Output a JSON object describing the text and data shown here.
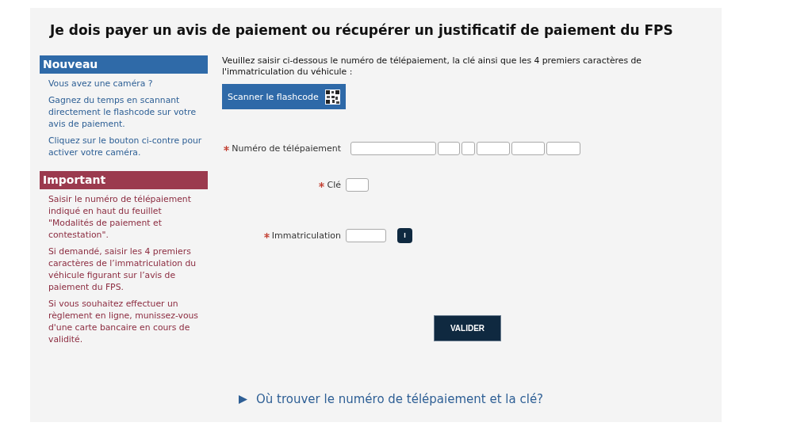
{
  "title": "Je dois payer un avis de paiement ou récupérer un justificatif de paiement du FPS",
  "sidebar": [
    {
      "kind": "new",
      "heading": "Nouveau",
      "paragraphs": [
        "Vous avez une caméra ?",
        "Gagnez du temps en scannant directement le flashcode sur votre avis de paiement.",
        "Cliquez sur le bouton ci-contre pour activer votre caméra."
      ]
    },
    {
      "kind": "important",
      "heading": "Important",
      "paragraphs": [
        "Saisir le numéro de télépaiement indiqué en haut du feuillet \"Modalités de paiement et contestation\".",
        "Si demandé, saisir les 4 premiers caractères de l’immatriculation du véhicule figurant sur l’avis de paiement du FPS.",
        "Si vous souhaitez effectuer un règlement en ligne, munissez-vous d'une carte bancaire en cours de validité."
      ]
    }
  ],
  "intro": "Veuillez saisir ci-dessous le numéro de télépaiement, la clé ainsi que les 4 premiers caractères de l'immatriculation du véhicule :",
  "scan_button": "Scanner le flashcode",
  "fields": [
    {
      "kind": "telepaiement",
      "label": "Numéro de télépaiement",
      "required": true
    },
    {
      "kind": "cle",
      "label": "Clé",
      "required": true
    },
    {
      "kind": "immatriculation",
      "label": "Immatriculation",
      "required": true,
      "info": "I"
    }
  ],
  "submit": "VALIDER",
  "help_link": "Où trouver le numéro de télépaiement et la clé?"
}
